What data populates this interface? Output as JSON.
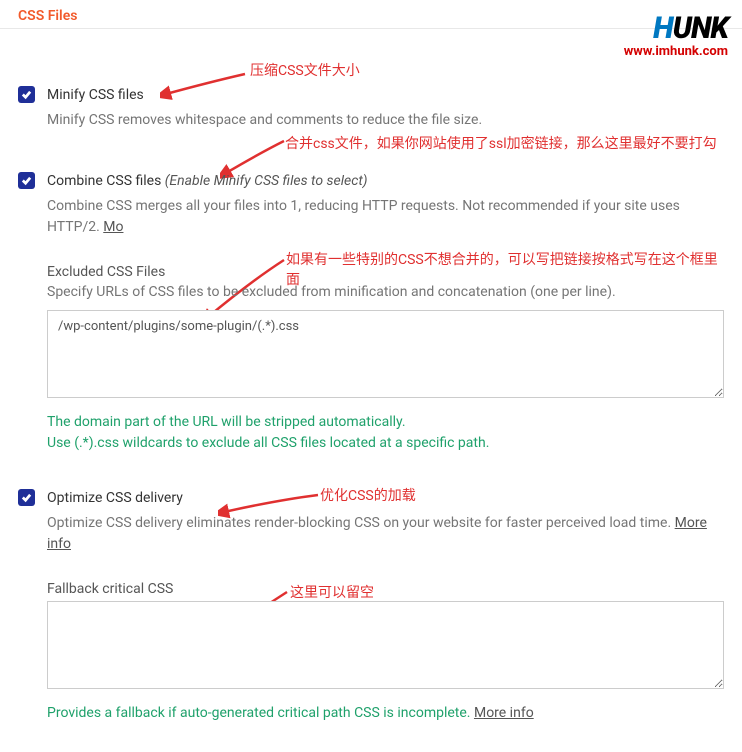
{
  "header": {
    "title": "CSS Files"
  },
  "logo": {
    "text_h": "H",
    "text_unk": "UNK",
    "url": "www.imhunk.com"
  },
  "annotations": {
    "minify": "压缩CSS文件大小",
    "combine": "合并css文件，如果你网站使用了ssl加密链接，那么这里最好不要打勾",
    "excluded": "如果有一些特别的CSS不想合并的，可以写把链接按格式写在这个框里面",
    "optimize": "优化CSS的加载",
    "fallback": "这里可以留空"
  },
  "settings": {
    "minify": {
      "label": "Minify CSS files",
      "desc": "Minify CSS removes whitespace and comments to reduce the file size.",
      "checked": true
    },
    "combine": {
      "label": "Combine CSS files",
      "label_italic": "(Enable Minify CSS files to select)",
      "desc": "Combine CSS merges all your files into 1, reducing HTTP requests. Not recommended if your site uses HTTP/2. ",
      "more": "Mo",
      "checked": true
    },
    "excluded": {
      "label": "Excluded CSS Files",
      "desc": "Specify URLs of CSS files to be excluded from minification and concatenation (one per line).",
      "value": "/wp-content/plugins/some-plugin/(.*).css",
      "hint1": "The domain part of the URL will be stripped automatically.",
      "hint2": "Use (.*).css wildcards to exclude all CSS files located at a specific path."
    },
    "optimize": {
      "label": "Optimize CSS delivery",
      "desc": "Optimize CSS delivery eliminates render-blocking CSS on your website for faster perceived load time. ",
      "more": "More info",
      "checked": true
    },
    "fallback": {
      "label": "Fallback critical CSS",
      "value": "",
      "hint": "Provides a fallback if auto-generated critical path CSS is incomplete. ",
      "more": "More info"
    }
  }
}
